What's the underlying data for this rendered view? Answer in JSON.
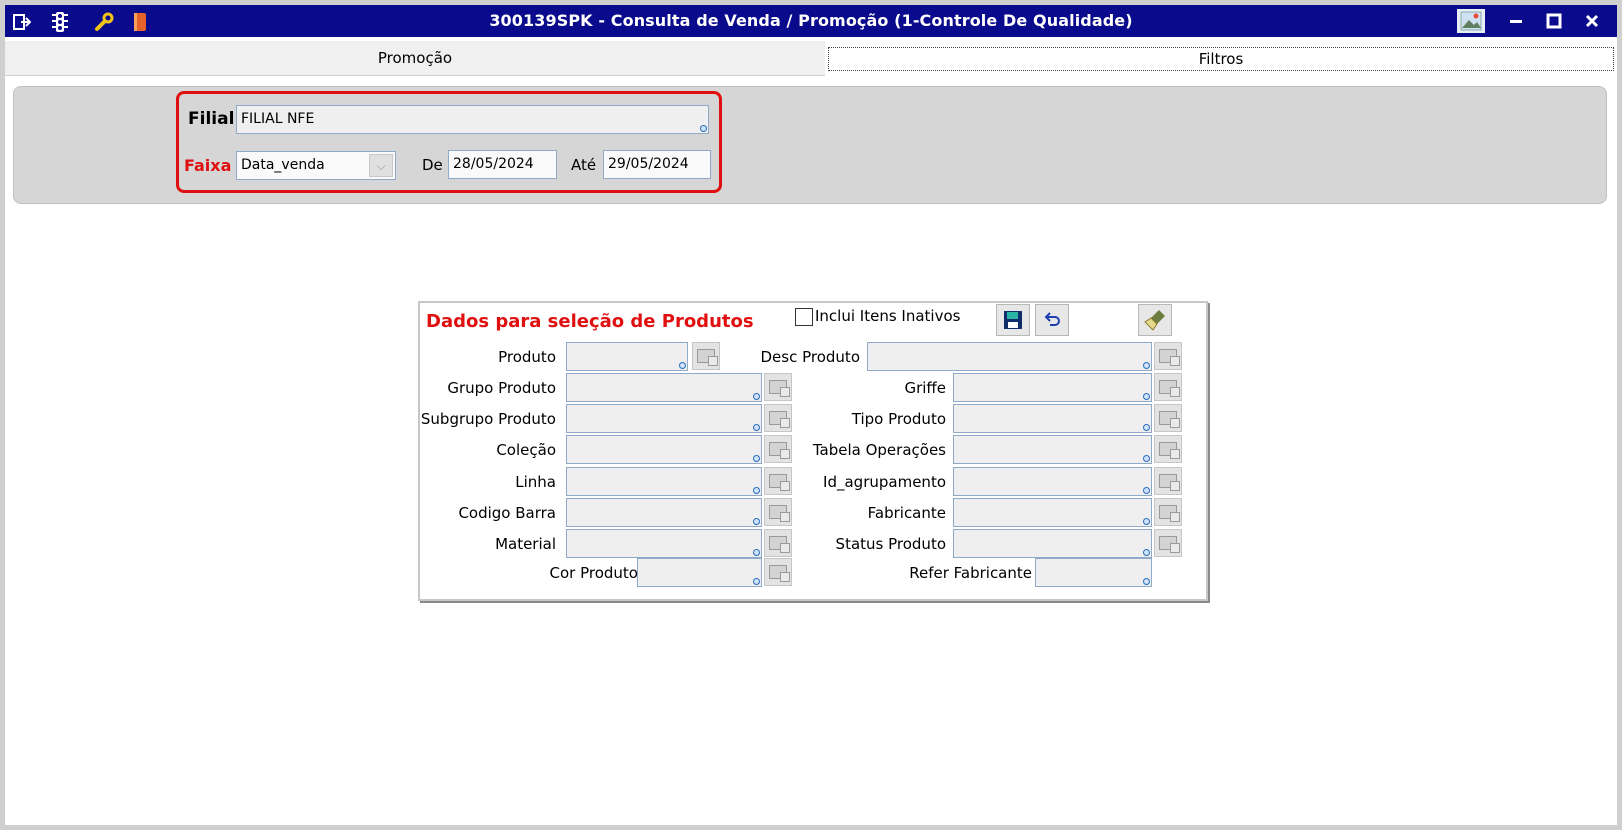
{
  "window": {
    "title": "300139SPK - Consulta de Venda / Promoção (1-Controle De Qualidade)",
    "toolbar_icons": [
      "exit-icon",
      "traffic-light-icon",
      "wrench-icon",
      "book-icon"
    ],
    "controls": [
      "picture-icon",
      "minimize-icon",
      "maximize-icon",
      "close-icon"
    ]
  },
  "tabs": [
    {
      "label": "Promoção"
    },
    {
      "label": "Filtros"
    }
  ],
  "filters": {
    "filial_label": "Filial",
    "filial_value": "FILIAL NFE",
    "faixa_label": "Faixa",
    "faixa_value": "Data_venda",
    "de_label": "De",
    "de_value": "28/05/2024",
    "ate_label": "Até",
    "ate_value": "29/05/2024"
  },
  "selection": {
    "title": "Dados para seleção de Produtos",
    "inactive_label": "Inclui Itens Inativos",
    "inactive_checked": false,
    "left_fields": [
      "Produto",
      "Grupo Produto",
      "Subgrupo Produto",
      "Coleção",
      "Linha",
      "Codigo Barra",
      "Material",
      "Cor Produto"
    ],
    "right_fields": [
      "Desc Produto",
      "Griffe",
      "Tipo Produto",
      "Tabela Operações",
      "Id_agrupamento",
      "Fabricante",
      "Status Produto",
      "Refer Fabricante"
    ]
  },
  "colors": {
    "titlebar": "#0a0a8c",
    "highlight": "#e01010",
    "required_label": "#e01010"
  }
}
